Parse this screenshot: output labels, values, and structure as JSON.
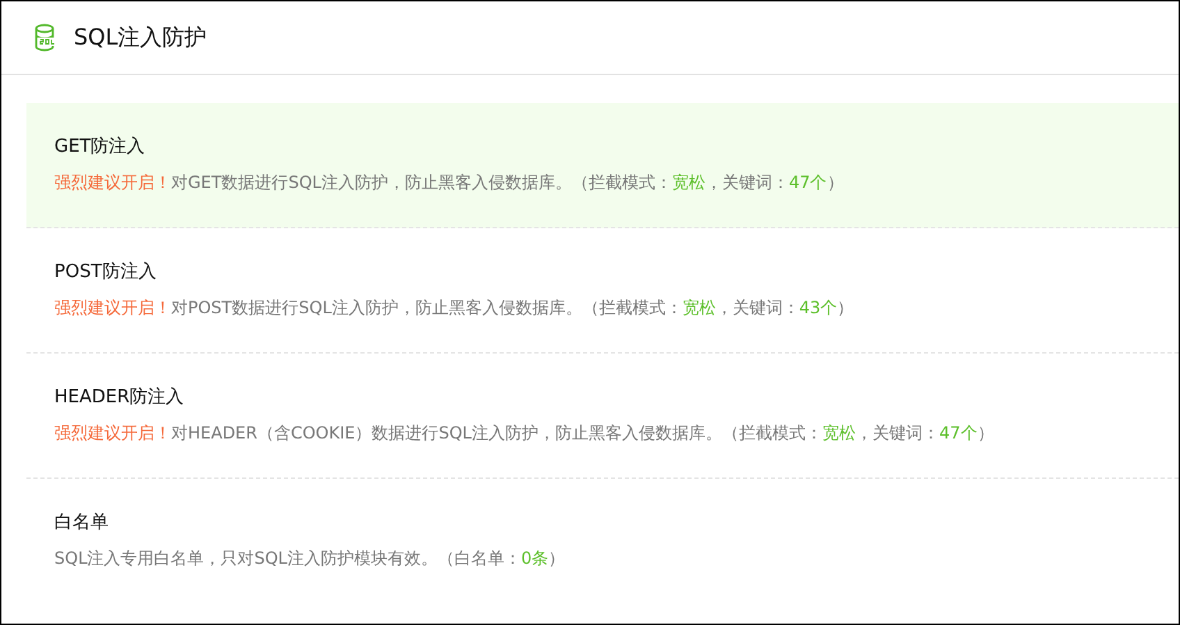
{
  "header": {
    "title": "SQL注入防护"
  },
  "rules": [
    {
      "title": "GET防注入",
      "selected": true,
      "description": [
        {
          "kind": "warn",
          "text": "强烈建议开启！"
        },
        {
          "kind": "plain",
          "text": "对GET数据进行SQL注入防护，防止黑客入侵数据库。（拦截模式："
        },
        {
          "kind": "value",
          "text": "宽松"
        },
        {
          "kind": "plain",
          "text": "，关键词："
        },
        {
          "kind": "value",
          "text": "47个"
        },
        {
          "kind": "plain",
          "text": "）"
        }
      ]
    },
    {
      "title": "POST防注入",
      "selected": false,
      "description": [
        {
          "kind": "warn",
          "text": "强烈建议开启！"
        },
        {
          "kind": "plain",
          "text": "对POST数据进行SQL注入防护，防止黑客入侵数据库。（拦截模式："
        },
        {
          "kind": "value",
          "text": "宽松"
        },
        {
          "kind": "plain",
          "text": "，关键词："
        },
        {
          "kind": "value",
          "text": "43个"
        },
        {
          "kind": "plain",
          "text": "）"
        }
      ]
    },
    {
      "title": "HEADER防注入",
      "selected": false,
      "description": [
        {
          "kind": "warn",
          "text": "强烈建议开启！"
        },
        {
          "kind": "plain",
          "text": "对HEADER（含COOKIE）数据进行SQL注入防护，防止黑客入侵数据库。（拦截模式："
        },
        {
          "kind": "value",
          "text": "宽松"
        },
        {
          "kind": "plain",
          "text": "，关键词："
        },
        {
          "kind": "value",
          "text": "47个"
        },
        {
          "kind": "plain",
          "text": "）"
        }
      ]
    },
    {
      "title": "白名单",
      "selected": false,
      "description": [
        {
          "kind": "plain",
          "text": "SQL注入专用白名单，只对SQL注入防护模块有效。（白名单："
        },
        {
          "kind": "value",
          "text": "0条"
        },
        {
          "kind": "plain",
          "text": "）"
        }
      ]
    }
  ]
}
